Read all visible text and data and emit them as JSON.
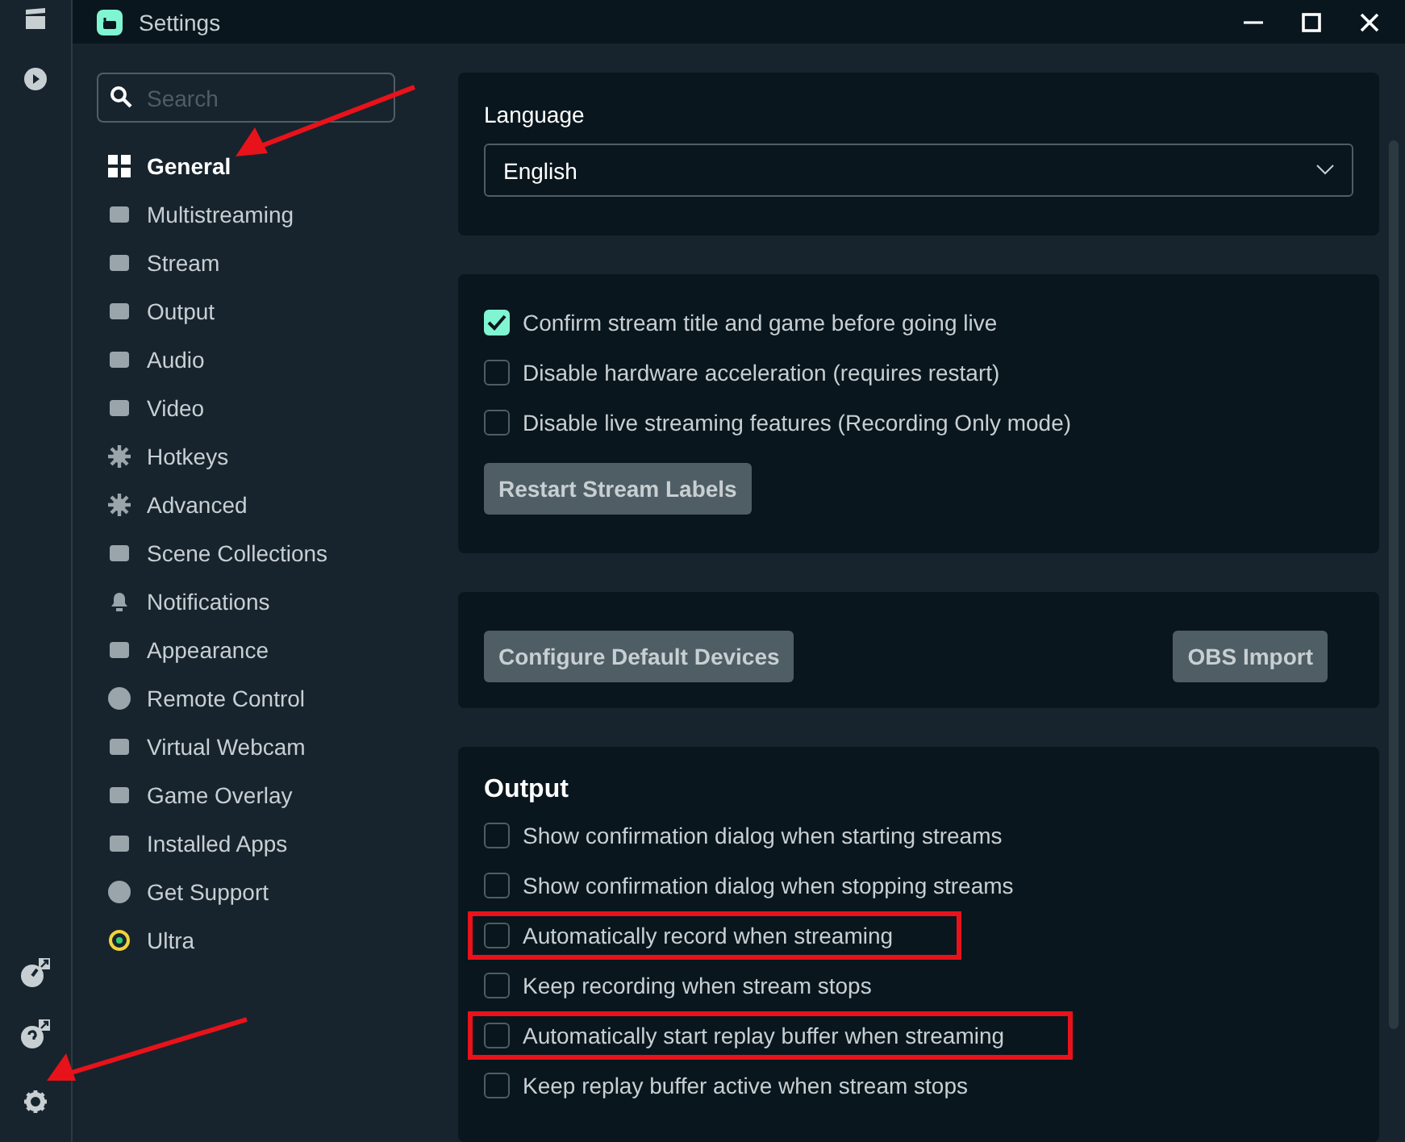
{
  "window": {
    "title": "Settings"
  },
  "sidebar": {
    "search": {
      "placeholder": "Search"
    },
    "items": [
      {
        "label": "General",
        "selected": true
      },
      {
        "label": "Multistreaming",
        "selected": false
      },
      {
        "label": "Stream",
        "selected": false
      },
      {
        "label": "Output",
        "selected": false
      },
      {
        "label": "Audio",
        "selected": false
      },
      {
        "label": "Video",
        "selected": false
      },
      {
        "label": "Hotkeys",
        "selected": false
      },
      {
        "label": "Advanced",
        "selected": false
      },
      {
        "label": "Scene Collections",
        "selected": false
      },
      {
        "label": "Notifications",
        "selected": false
      },
      {
        "label": "Appearance",
        "selected": false
      },
      {
        "label": "Remote Control",
        "selected": false
      },
      {
        "label": "Virtual Webcam",
        "selected": false
      },
      {
        "label": "Game Overlay",
        "selected": false
      },
      {
        "label": "Installed Apps",
        "selected": false
      },
      {
        "label": "Get Support",
        "selected": false
      },
      {
        "label": "Ultra",
        "selected": false
      }
    ]
  },
  "language": {
    "label": "Language",
    "value": "English"
  },
  "general": {
    "options": [
      {
        "label": "Confirm stream title and game before going live",
        "checked": true
      },
      {
        "label": "Disable hardware acceleration (requires restart)",
        "checked": false
      },
      {
        "label": "Disable live streaming features (Recording Only mode)",
        "checked": false
      }
    ],
    "button": "Restart Stream Labels"
  },
  "devices": {
    "buttons": [
      "Configure Default Devices",
      "OBS Import"
    ]
  },
  "output": {
    "title": "Output",
    "options": [
      {
        "label": "Show confirmation dialog when starting streams",
        "checked": false,
        "highlighted": false
      },
      {
        "label": "Show confirmation dialog when stopping streams",
        "checked": false,
        "highlighted": false
      },
      {
        "label": "Automatically record when streaming",
        "checked": false,
        "highlighted": true
      },
      {
        "label": "Keep recording when stream stops",
        "checked": false,
        "highlighted": false
      },
      {
        "label": "Automatically start replay buffer when streaming",
        "checked": false,
        "highlighted": true
      },
      {
        "label": "Keep replay buffer active when stream stops",
        "checked": false,
        "highlighted": false
      }
    ]
  }
}
